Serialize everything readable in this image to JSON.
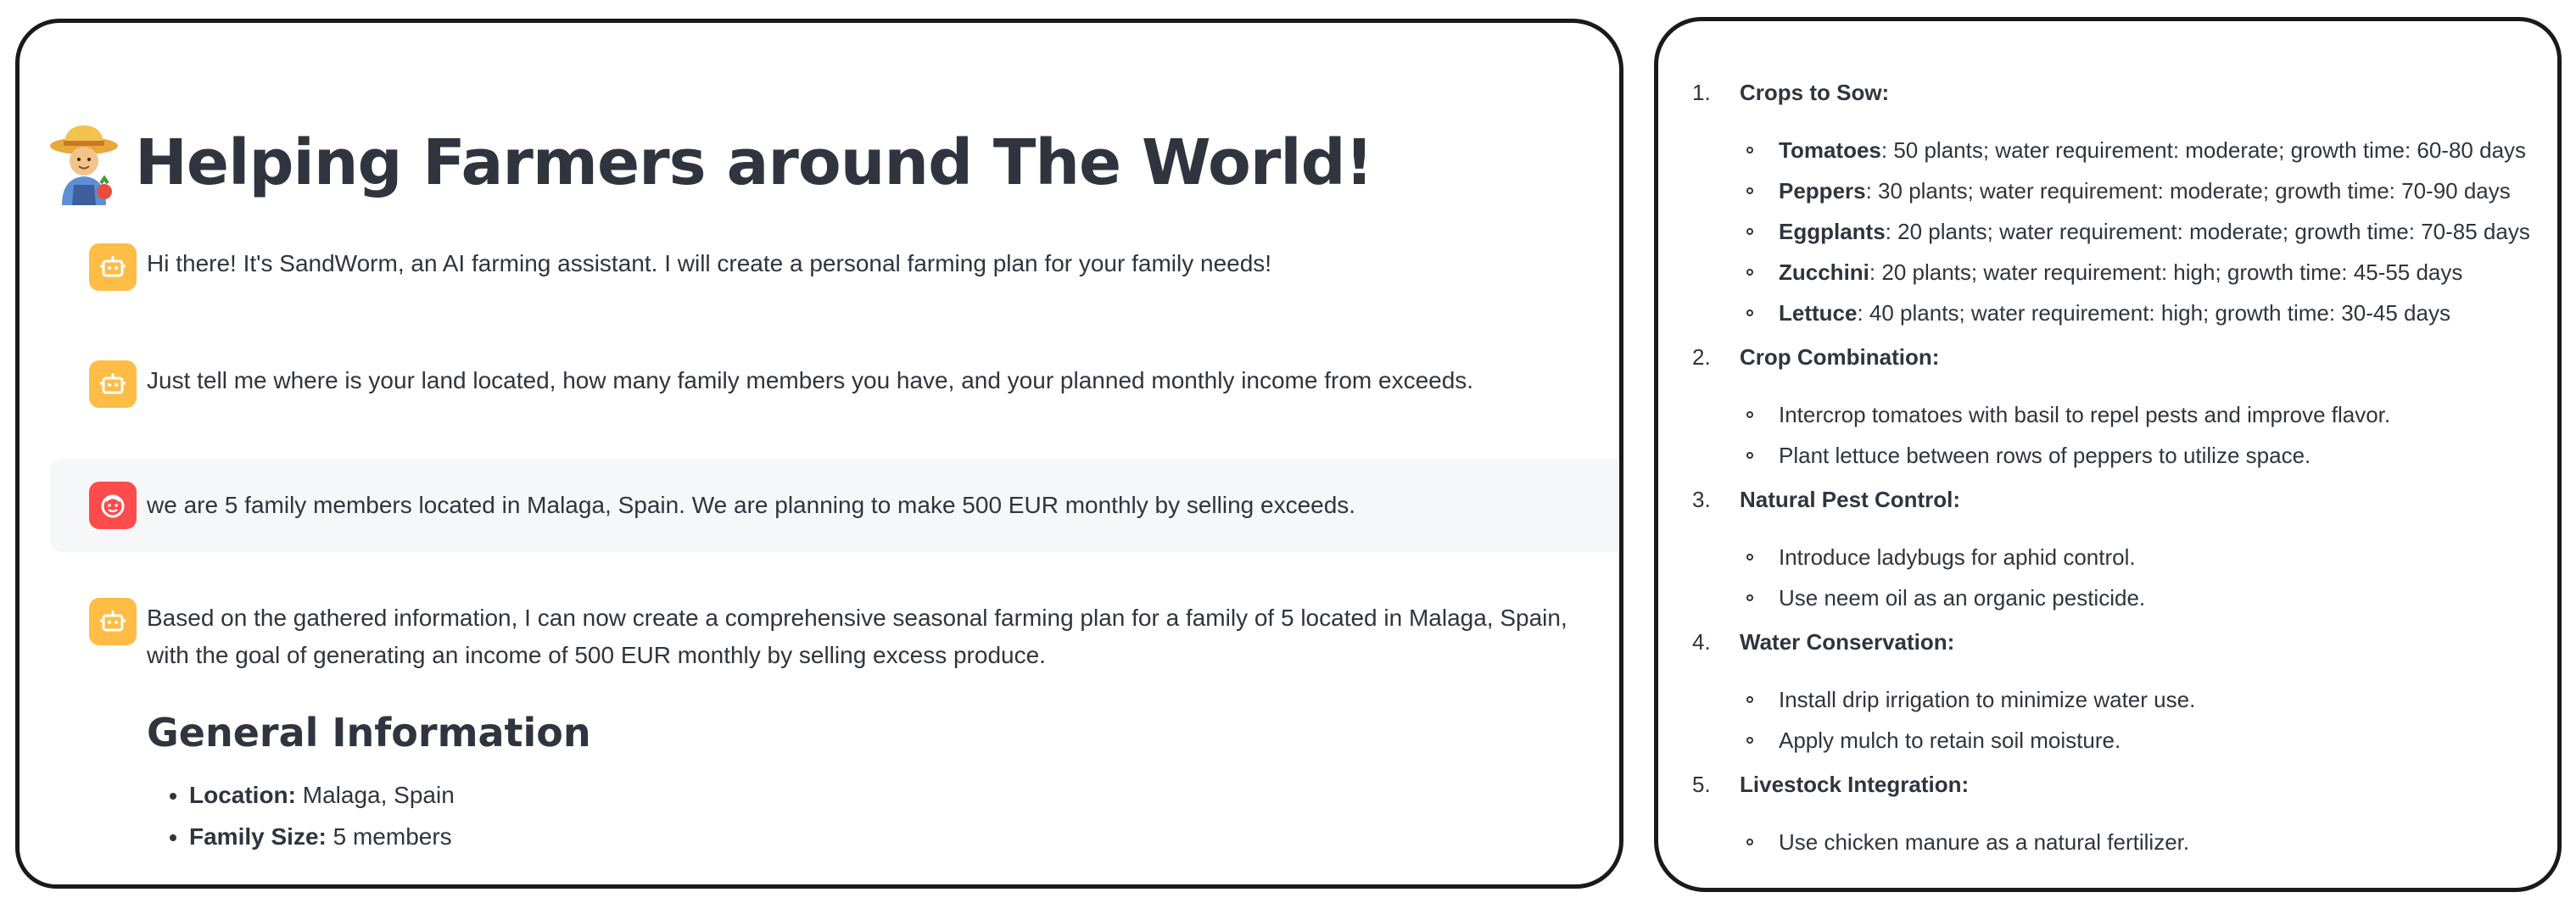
{
  "app": {
    "title": "Helping Farmers around The World!",
    "accent_bot": "#ffbd45",
    "accent_user": "#ff4b4b",
    "icons": {
      "title": "farmer-emoji-icon",
      "bot": "robot-icon",
      "user": "face-icon"
    }
  },
  "chat": {
    "messages": [
      {
        "role": "assistant",
        "text": "Hi there! It's SandWorm, an AI farming assistant. I will create a personal farming plan for your family needs!"
      },
      {
        "role": "assistant",
        "text": "Just tell me where is your land located, how many family members you have, and your planned monthly income from exceeds."
      },
      {
        "role": "user",
        "text": "we are 5 family members located in Malaga, Spain. We are planning to make 500 EUR monthly by selling exceeds."
      },
      {
        "role": "assistant",
        "text": "Based on the gathered information, I can now create a comprehensive seasonal farming plan for a family of 5 located in Malaga, Spain, with the goal of generating an income of 500 EUR monthly by selling excess produce."
      }
    ],
    "general_info": {
      "heading": "General Information",
      "items": [
        {
          "label": "Location:",
          "value": " Malaga, Spain"
        },
        {
          "label": "Family Size:",
          "value": " 5 members"
        }
      ]
    }
  },
  "plan": {
    "sections": [
      {
        "number": "1.",
        "title": "Crops to Sow:",
        "items": [
          {
            "bold": "Tomatoes",
            "text": ": 50 plants; water requirement: moderate; growth time: 60-80 days"
          },
          {
            "bold": "Peppers",
            "text": ": 30 plants; water requirement: moderate; growth time: 70-90 days"
          },
          {
            "bold": "Eggplants",
            "text": ": 20 plants; water requirement: moderate; growth time: 70-85 days"
          },
          {
            "bold": "Zucchini",
            "text": ": 20 plants; water requirement: high; growth time: 45-55 days"
          },
          {
            "bold": "Lettuce",
            "text": ": 40 plants; water requirement: high; growth time: 30-45 days"
          }
        ]
      },
      {
        "number": "2.",
        "title": "Crop Combination:",
        "items": [
          {
            "bold": "",
            "text": "Intercrop tomatoes with basil to repel pests and improve flavor."
          },
          {
            "bold": "",
            "text": "Plant lettuce between rows of peppers to utilize space."
          }
        ]
      },
      {
        "number": "3.",
        "title": "Natural Pest Control:",
        "items": [
          {
            "bold": "",
            "text": "Introduce ladybugs for aphid control."
          },
          {
            "bold": "",
            "text": "Use neem oil as an organic pesticide."
          }
        ]
      },
      {
        "number": "4.",
        "title": "Water Conservation:",
        "items": [
          {
            "bold": "",
            "text": "Install drip irrigation to minimize water use."
          },
          {
            "bold": "",
            "text": "Apply mulch to retain soil moisture."
          }
        ]
      },
      {
        "number": "5.",
        "title": "Livestock Integration:",
        "items": [
          {
            "bold": "",
            "text": "Use chicken manure as a natural fertilizer."
          }
        ]
      }
    ]
  }
}
